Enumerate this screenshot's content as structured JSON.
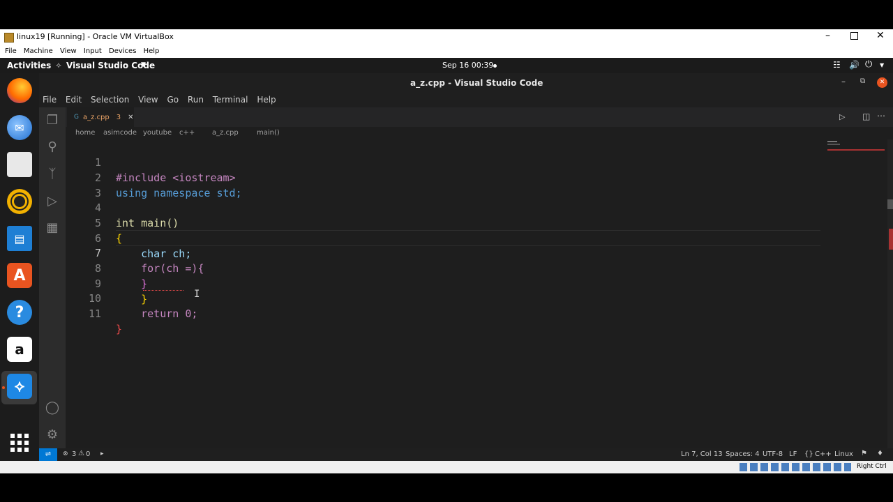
{
  "vbox": {
    "title": "linux19 [Running] - Oracle VM VirtualBox",
    "menu": [
      "File",
      "Machine",
      "View",
      "Input",
      "Devices",
      "Help"
    ],
    "host_key": "Right Ctrl"
  },
  "gnome": {
    "activities": "Activities",
    "app_name": "Visual Studio Code",
    "clock": "Sep 16  00:39"
  },
  "vscode": {
    "window_title": "a_z.cpp - Visual Studio Code",
    "menu": [
      "File",
      "Edit",
      "Selection",
      "View",
      "Go",
      "Run",
      "Terminal",
      "Help"
    ],
    "tab": {
      "name": "a_z.cpp",
      "problems": "3"
    },
    "breadcrumb": [
      "home",
      "asimcode",
      "youtube",
      "c++",
      "a_z.cpp",
      "main()"
    ],
    "code_lines": [
      {
        "n": "1",
        "text": "#include <iostream>"
      },
      {
        "n": "2",
        "text": "using namespace std;"
      },
      {
        "n": "3",
        "text": ""
      },
      {
        "n": "4",
        "text": "int main()"
      },
      {
        "n": "5",
        "text": "{"
      },
      {
        "n": "6",
        "text": "    char ch;"
      },
      {
        "n": "7",
        "text": "    for(ch =){"
      },
      {
        "n": "8",
        "text": "    }"
      },
      {
        "n": "9",
        "text": "    }"
      },
      {
        "n": "10",
        "text": "    return 0;"
      },
      {
        "n": "11",
        "text": "}"
      }
    ],
    "status": {
      "errors": "3",
      "warnings": "0",
      "position": "Ln 7, Col 13",
      "spaces": "Spaces: 4",
      "encoding": "UTF-8",
      "eol": "LF",
      "language": "C++",
      "platform": "Linux"
    }
  },
  "colors": {
    "accent": "#0078d4",
    "tab_modified": "#e8a266"
  }
}
